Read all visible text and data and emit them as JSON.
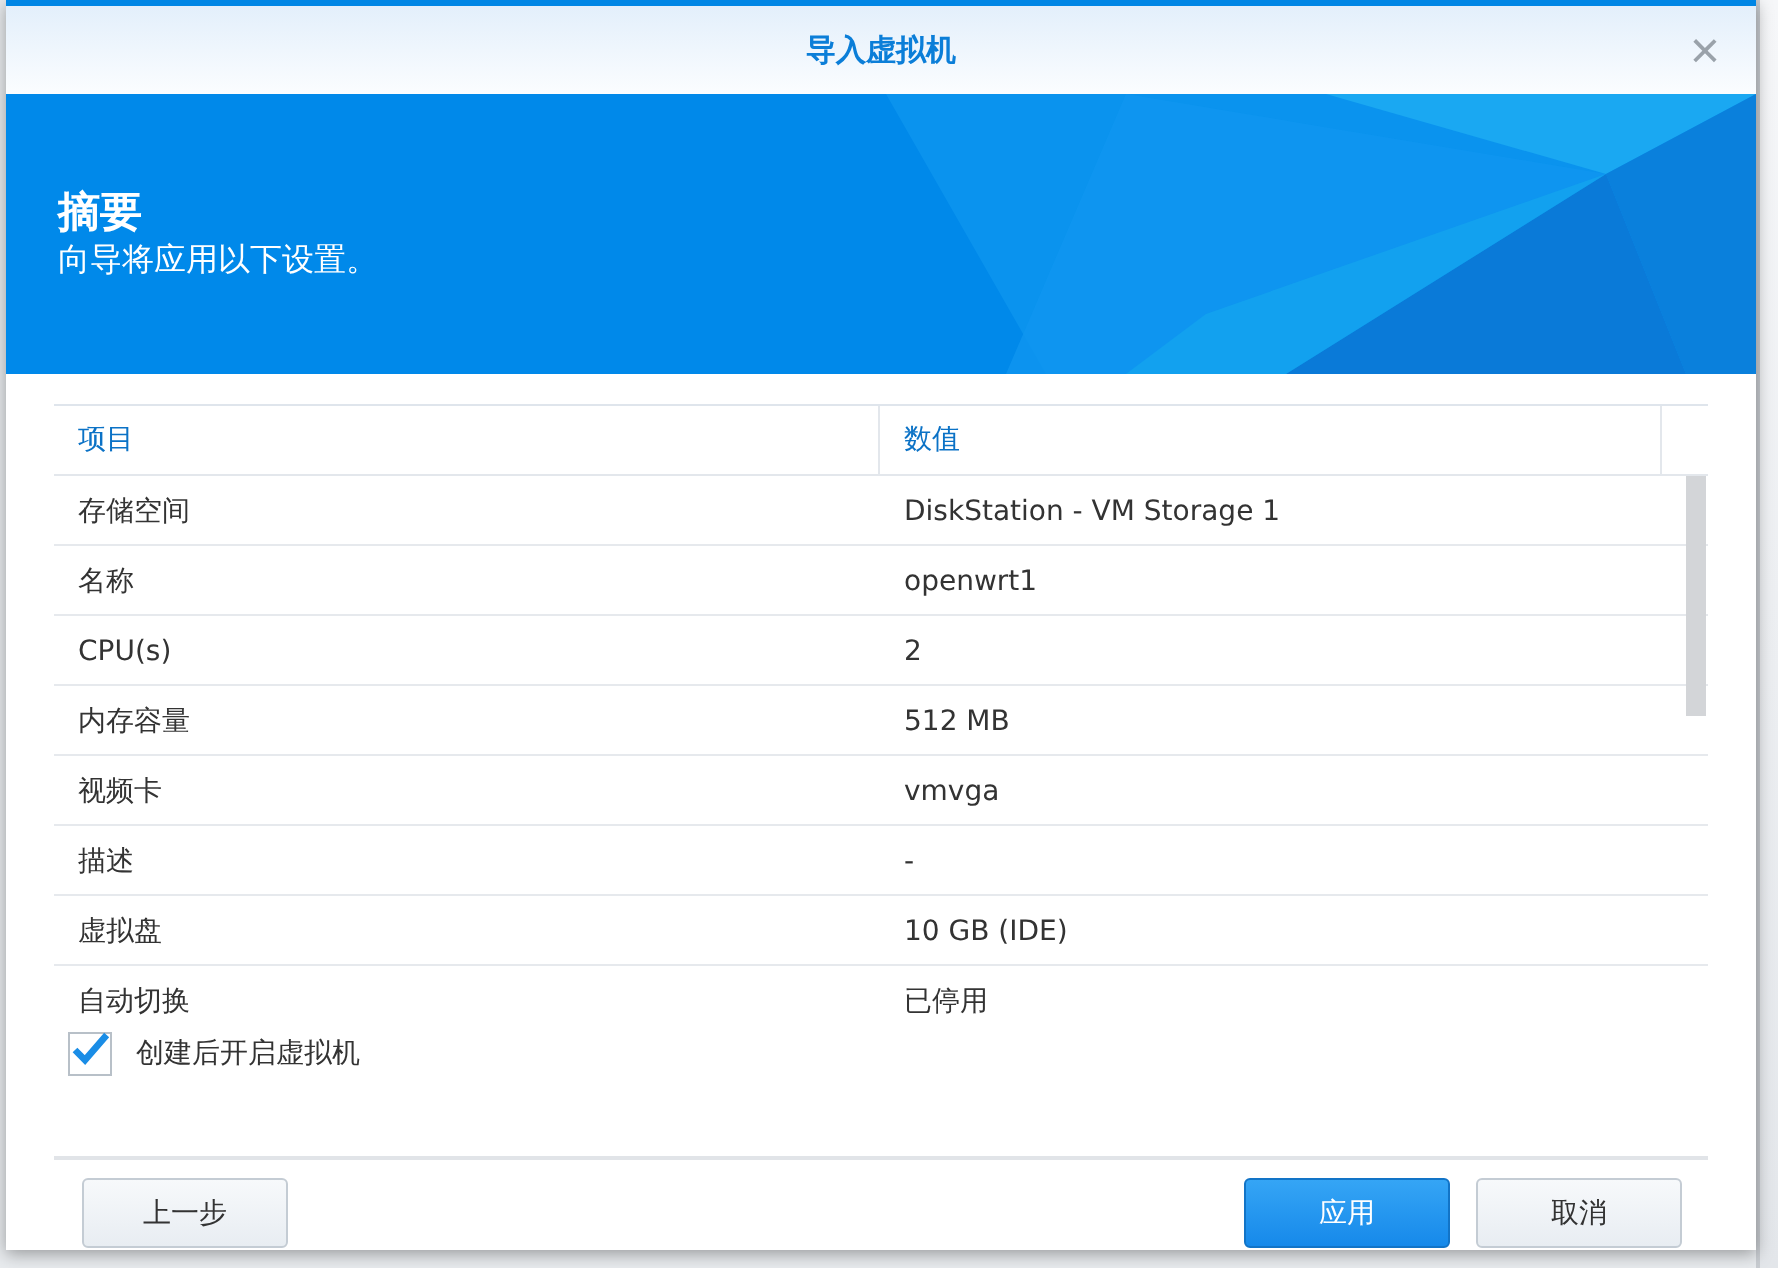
{
  "window": {
    "title": "导入虚拟机",
    "close": "×"
  },
  "header": {
    "title": "摘要",
    "subtitle": "向导将应用以下设置。"
  },
  "table": {
    "columns": [
      "项目",
      "数值"
    ],
    "rows": [
      {
        "item": "存储空间",
        "value": "DiskStation - VM Storage 1"
      },
      {
        "item": "名称",
        "value": "openwrt1"
      },
      {
        "item": "CPU(s)",
        "value": "2"
      },
      {
        "item": "内存容量",
        "value": "512 MB"
      },
      {
        "item": "视频卡",
        "value": "vmvga"
      },
      {
        "item": "描述",
        "value": "-"
      },
      {
        "item": "虚拟盘",
        "value": "10 GB (IDE)"
      },
      {
        "item": "自动切换",
        "value": "已停用"
      }
    ]
  },
  "option": {
    "label": "创建后开启虚拟机",
    "checked": true
  },
  "footer": {
    "left_buttons": [
      {
        "label": "上一步",
        "kind": "secondary"
      }
    ],
    "right_buttons": [
      {
        "label": "应用",
        "kind": "primary"
      },
      {
        "label": "取消",
        "kind": "secondary"
      }
    ]
  }
}
